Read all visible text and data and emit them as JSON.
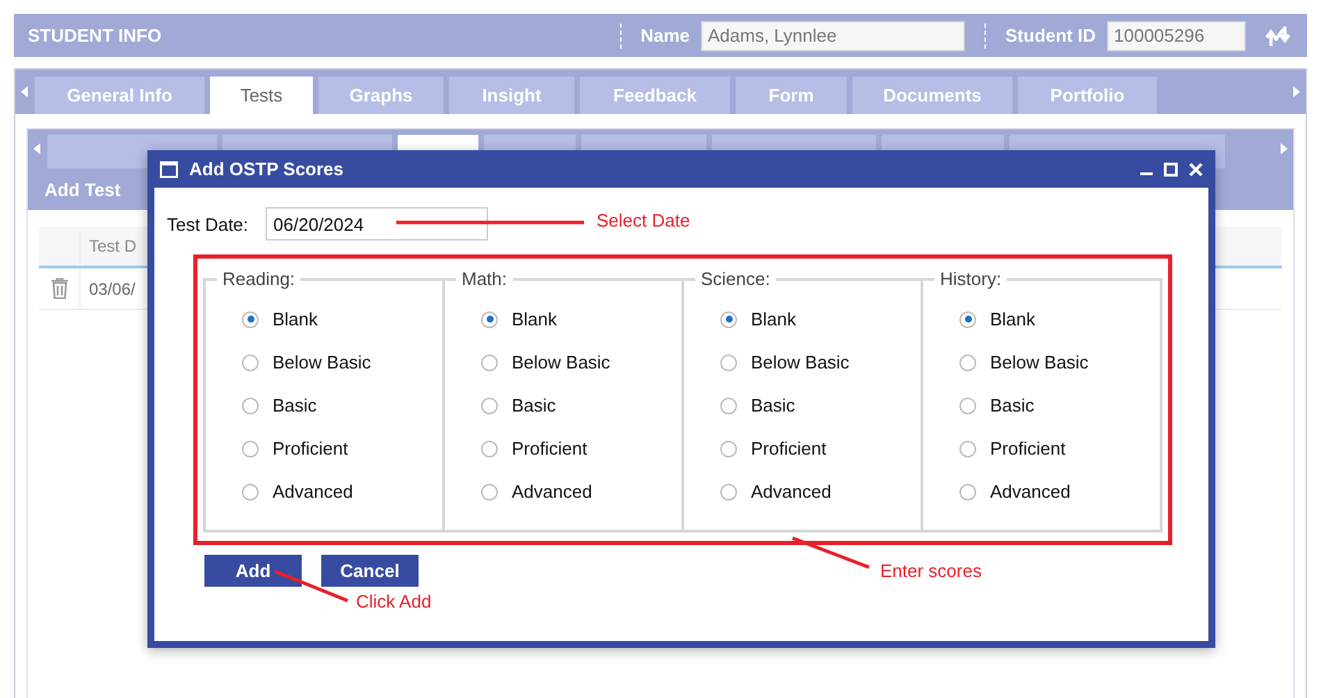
{
  "header": {
    "title": "STUDENT INFO",
    "name_label": "Name",
    "name_value": "Adams, Lynnlee",
    "id_label": "Student ID",
    "id_value": "100005296"
  },
  "tabs": [
    {
      "label": "General Info",
      "selected": false
    },
    {
      "label": "Tests",
      "selected": true
    },
    {
      "label": "Graphs",
      "selected": false
    },
    {
      "label": "Insight",
      "selected": false
    },
    {
      "label": "Feedback",
      "selected": false
    },
    {
      "label": "Form",
      "selected": false
    },
    {
      "label": "Documents",
      "selected": false
    },
    {
      "label": "Portfolio",
      "selected": false
    }
  ],
  "subtabs": [
    {
      "selected": false
    },
    {
      "selected": false
    },
    {
      "selected": true
    },
    {
      "selected": false
    },
    {
      "selected": false
    },
    {
      "selected": false
    },
    {
      "selected": false
    },
    {
      "selected": false
    }
  ],
  "panel_title": "Add Test",
  "table": {
    "columns": [
      "Test D"
    ],
    "rows": [
      [
        "03/06/"
      ]
    ]
  },
  "dialog": {
    "title": "Add OSTP Scores",
    "date_label": "Test Date:",
    "date_value": "06/20/2024",
    "groups": [
      {
        "label": "Reading:",
        "options": [
          {
            "label": "Blank",
            "selected": true
          },
          {
            "label": "Below Basic",
            "selected": false
          },
          {
            "label": "Basic",
            "selected": false
          },
          {
            "label": "Proficient",
            "selected": false
          },
          {
            "label": "Advanced",
            "selected": false
          }
        ]
      },
      {
        "label": "Math:",
        "options": [
          {
            "label": "Blank",
            "selected": true
          },
          {
            "label": "Below Basic",
            "selected": false
          },
          {
            "label": "Basic",
            "selected": false
          },
          {
            "label": "Proficient",
            "selected": false
          },
          {
            "label": "Advanced",
            "selected": false
          }
        ]
      },
      {
        "label": "Science:",
        "options": [
          {
            "label": "Blank",
            "selected": true
          },
          {
            "label": "Below Basic",
            "selected": false
          },
          {
            "label": "Basic",
            "selected": false
          },
          {
            "label": "Proficient",
            "selected": false
          },
          {
            "label": "Advanced",
            "selected": false
          }
        ]
      },
      {
        "label": "History:",
        "options": [
          {
            "label": "Blank",
            "selected": true
          },
          {
            "label": "Below Basic",
            "selected": false
          },
          {
            "label": "Basic",
            "selected": false
          },
          {
            "label": "Proficient",
            "selected": false
          },
          {
            "label": "Advanced",
            "selected": false
          }
        ]
      }
    ],
    "buttons": [
      "Add",
      "Cancel"
    ]
  },
  "annotations": [
    "Select Date",
    "Enter scores",
    "Click Add"
  ]
}
